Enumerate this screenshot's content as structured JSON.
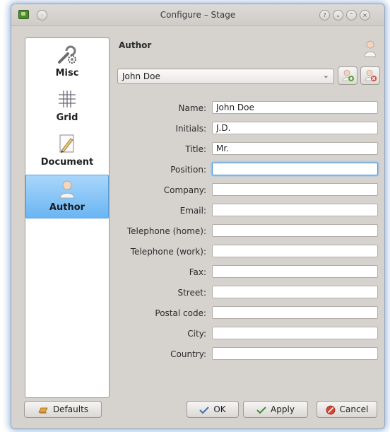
{
  "window": {
    "title": "Configure – Stage"
  },
  "sidebar": {
    "items": [
      {
        "label": "Misc",
        "icon": "wrench-gear-icon"
      },
      {
        "label": "Grid",
        "icon": "grid-icon"
      },
      {
        "label": "Document",
        "icon": "pen-document-icon"
      },
      {
        "label": "Author",
        "icon": "person-icon",
        "selected": true
      }
    ]
  },
  "section": {
    "title": "Author"
  },
  "profile": {
    "selected": "John Doe"
  },
  "form": {
    "fields": [
      {
        "label": "Name:",
        "value": "John Doe"
      },
      {
        "label": "Initials:",
        "value": "J.D."
      },
      {
        "label": "Title:",
        "value": "Mr."
      },
      {
        "label": "Position:",
        "value": ""
      },
      {
        "label": "Company:",
        "value": ""
      },
      {
        "label": "Email:",
        "value": ""
      },
      {
        "label": "Telephone (home):",
        "value": ""
      },
      {
        "label": "Telephone (work):",
        "value": ""
      },
      {
        "label": "Fax:",
        "value": ""
      },
      {
        "label": "Street:",
        "value": ""
      },
      {
        "label": "Postal code:",
        "value": ""
      },
      {
        "label": "City:",
        "value": ""
      },
      {
        "label": "Country:",
        "value": ""
      }
    ]
  },
  "buttons": {
    "defaults": "Defaults",
    "ok": "OK",
    "apply": "Apply",
    "cancel": "Cancel"
  },
  "colors": {
    "selection": "#6ab5f3",
    "focus": "#4a97db"
  }
}
